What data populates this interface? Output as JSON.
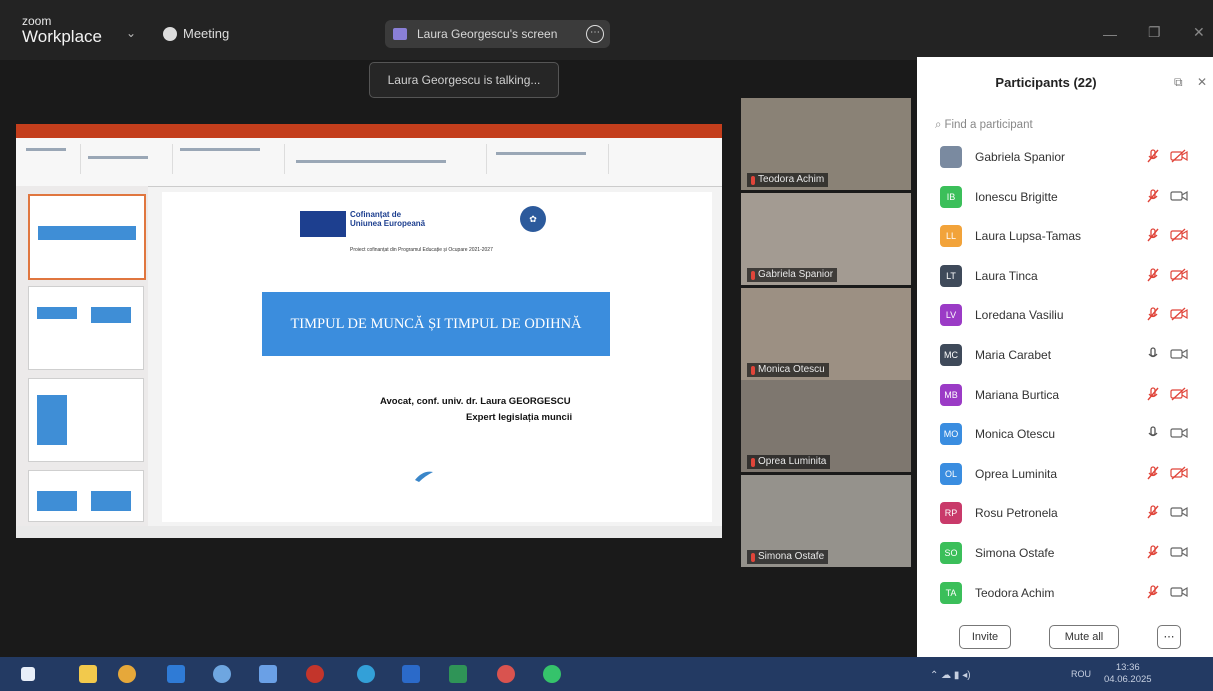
{
  "app": {
    "brand_small": "zoom",
    "brand": "Workplace",
    "meeting_label": "Meeting"
  },
  "share": {
    "title": "Laura Georgescu's screen",
    "talking": "Laura Georgescu is talking..."
  },
  "slide": {
    "eu_line1": "Cofinanțat de",
    "eu_line2": "Uniunea Europeană",
    "program": "Proiect cofinanțat din Programul Educație și Ocupare 2021-2027",
    "title": "TIMPUL DE MUNCĂ ȘI TIMPUL DE ODIHNĂ",
    "author": "Avocat, conf. univ. dr. Laura GEORGESCU",
    "expert": "Expert legislația muncii"
  },
  "videos": [
    {
      "name": "Teodora Achim"
    },
    {
      "name": "Gabriela Spanior"
    },
    {
      "name": "Monica Otescu"
    },
    {
      "name": "Oprea Luminita"
    },
    {
      "name": "Simona Ostafe"
    }
  ],
  "participants": {
    "title": "Participants (22)",
    "search_placeholder": "Find a participant",
    "items": [
      {
        "initials": "",
        "name": "Gabriela Spanior",
        "color": "#7a8aa0",
        "mic": "muted",
        "cam": "off"
      },
      {
        "initials": "IB",
        "name": "Ionescu Brigitte",
        "color": "#3bbf5a",
        "mic": "muted",
        "cam": "on"
      },
      {
        "initials": "LL",
        "name": "Laura Lupsa-Tamas",
        "color": "#f2a33a",
        "mic": "muted",
        "cam": "off"
      },
      {
        "initials": "LT",
        "name": "Laura Tinca",
        "color": "#3f4a5a",
        "mic": "muted",
        "cam": "off"
      },
      {
        "initials": "LV",
        "name": "Loredana Vasiliu",
        "color": "#9b3bc6",
        "mic": "muted",
        "cam": "off"
      },
      {
        "initials": "MC",
        "name": "Maria Carabet",
        "color": "#3f4a5a",
        "mic": "unmuted",
        "cam": "on"
      },
      {
        "initials": "MB",
        "name": "Mariana Burtica",
        "color": "#9b3bc6",
        "mic": "muted",
        "cam": "off"
      },
      {
        "initials": "MO",
        "name": "Monica Otescu",
        "color": "#3a8de0",
        "mic": "unmuted",
        "cam": "on"
      },
      {
        "initials": "OL",
        "name": "Oprea Luminita",
        "color": "#3a8de0",
        "mic": "muted",
        "cam": "off"
      },
      {
        "initials": "RP",
        "name": "Rosu Petronela",
        "color": "#c93a6a",
        "mic": "muted",
        "cam": "on"
      },
      {
        "initials": "SO",
        "name": "Simona Ostafe",
        "color": "#3bbf5a",
        "mic": "muted",
        "cam": "on"
      },
      {
        "initials": "TA",
        "name": "Teodora Achim",
        "color": "#3bbf5a",
        "mic": "muted",
        "cam": "on"
      }
    ],
    "invite": "Invite",
    "mute_all": "Mute all",
    "more": "⋯"
  },
  "taskbar": {
    "lang": "ROU",
    "time": "13:36",
    "date": "04.06.2025"
  },
  "colors": {
    "muted_red": "#e0453a",
    "accent_blue": "#0e72ed",
    "taskbar": "#233a63"
  }
}
